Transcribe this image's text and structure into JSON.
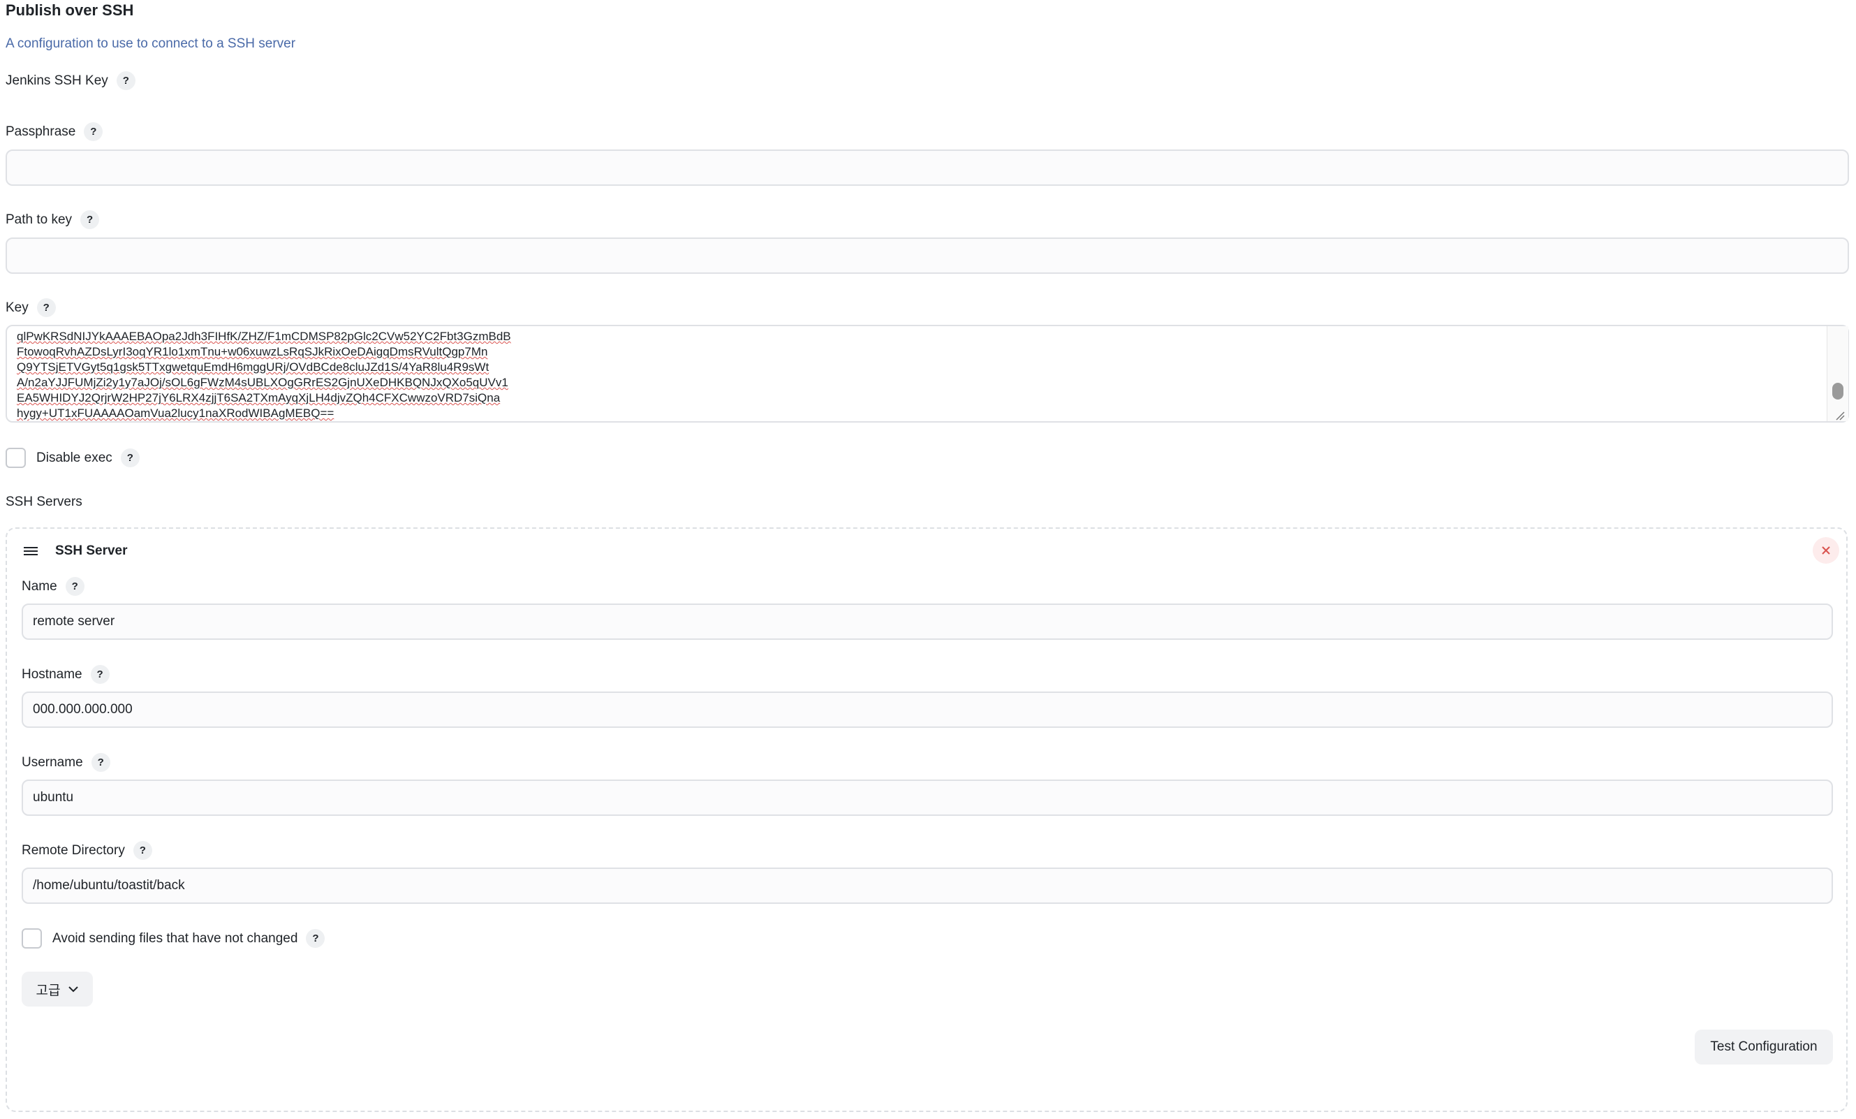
{
  "section": {
    "title": "Publish over SSH",
    "description": "A configuration to use to connect to a SSH server"
  },
  "jenkins_key": {
    "label": "Jenkins SSH Key",
    "help": "?"
  },
  "passphrase": {
    "label": "Passphrase",
    "help": "?",
    "value": ""
  },
  "path_to_key": {
    "label": "Path to key",
    "help": "?",
    "value": ""
  },
  "key": {
    "label": "Key",
    "help": "?",
    "value": "qlPwKRSdNIJYkAAAEBAOpa2Jdh3FIHfK/ZHZ/F1mCDMSP82pGlc2CVw52YC2Fbt3GzmBdB\nFtowoqRvhAZDsLyrI3oqYR1lo1xmTnu+w06xuwzLsRqSJkRixOeDAigqDmsRVultQgp7Mn\nQ9YTSjETVGyt5q1gsk5TTxgwetquEmdH6mggURj/OVdBCde8cluJZd1S/4YaR8lu4R9sWt\nA/n2aYJJFUMjZi2y1y7aJOj/sOL6gFWzM4sUBLXOgGRrES2GjnUXeDHKBQNJxQXo5qUVv1\nEA5WHIDYJ2QrjrW2HP27jY6LRX4zjjT6SA2TXmAyqXjLH4djvZQh4CFXCwwzoVRD7siQna\nhygy+UT1xFUAAAAOamVua2lucy1naXRodWIBAgMEBQ==\n-----END OPENSSH PRIVATE KEY-----"
  },
  "disable_exec": {
    "label": "Disable exec",
    "help": "?",
    "checked": false
  },
  "ssh_servers": {
    "label": "SSH Servers",
    "server": {
      "title": "SSH Server",
      "name": {
        "label": "Name",
        "help": "?",
        "value": "remote server"
      },
      "hostname": {
        "label": "Hostname",
        "help": "?",
        "value": "000.000.000.000"
      },
      "username": {
        "label": "Username",
        "help": "?",
        "value": "ubuntu"
      },
      "remote_directory": {
        "label": "Remote Directory",
        "help": "?",
        "value": "/home/ubuntu/toastit/back"
      },
      "avoid_sending": {
        "label": "Avoid sending files that have not changed",
        "help": "?",
        "checked": false
      },
      "advanced_label": "고급",
      "test_button": "Test Configuration"
    }
  },
  "icons": {
    "drag_handle": "drag-handle-icon",
    "close": "close-icon",
    "chevron": "chevron-down-icon"
  },
  "colors": {
    "description_link": "#4a6aa8",
    "close_icon": "#d9534f",
    "input_border": "#dfe1e5"
  }
}
